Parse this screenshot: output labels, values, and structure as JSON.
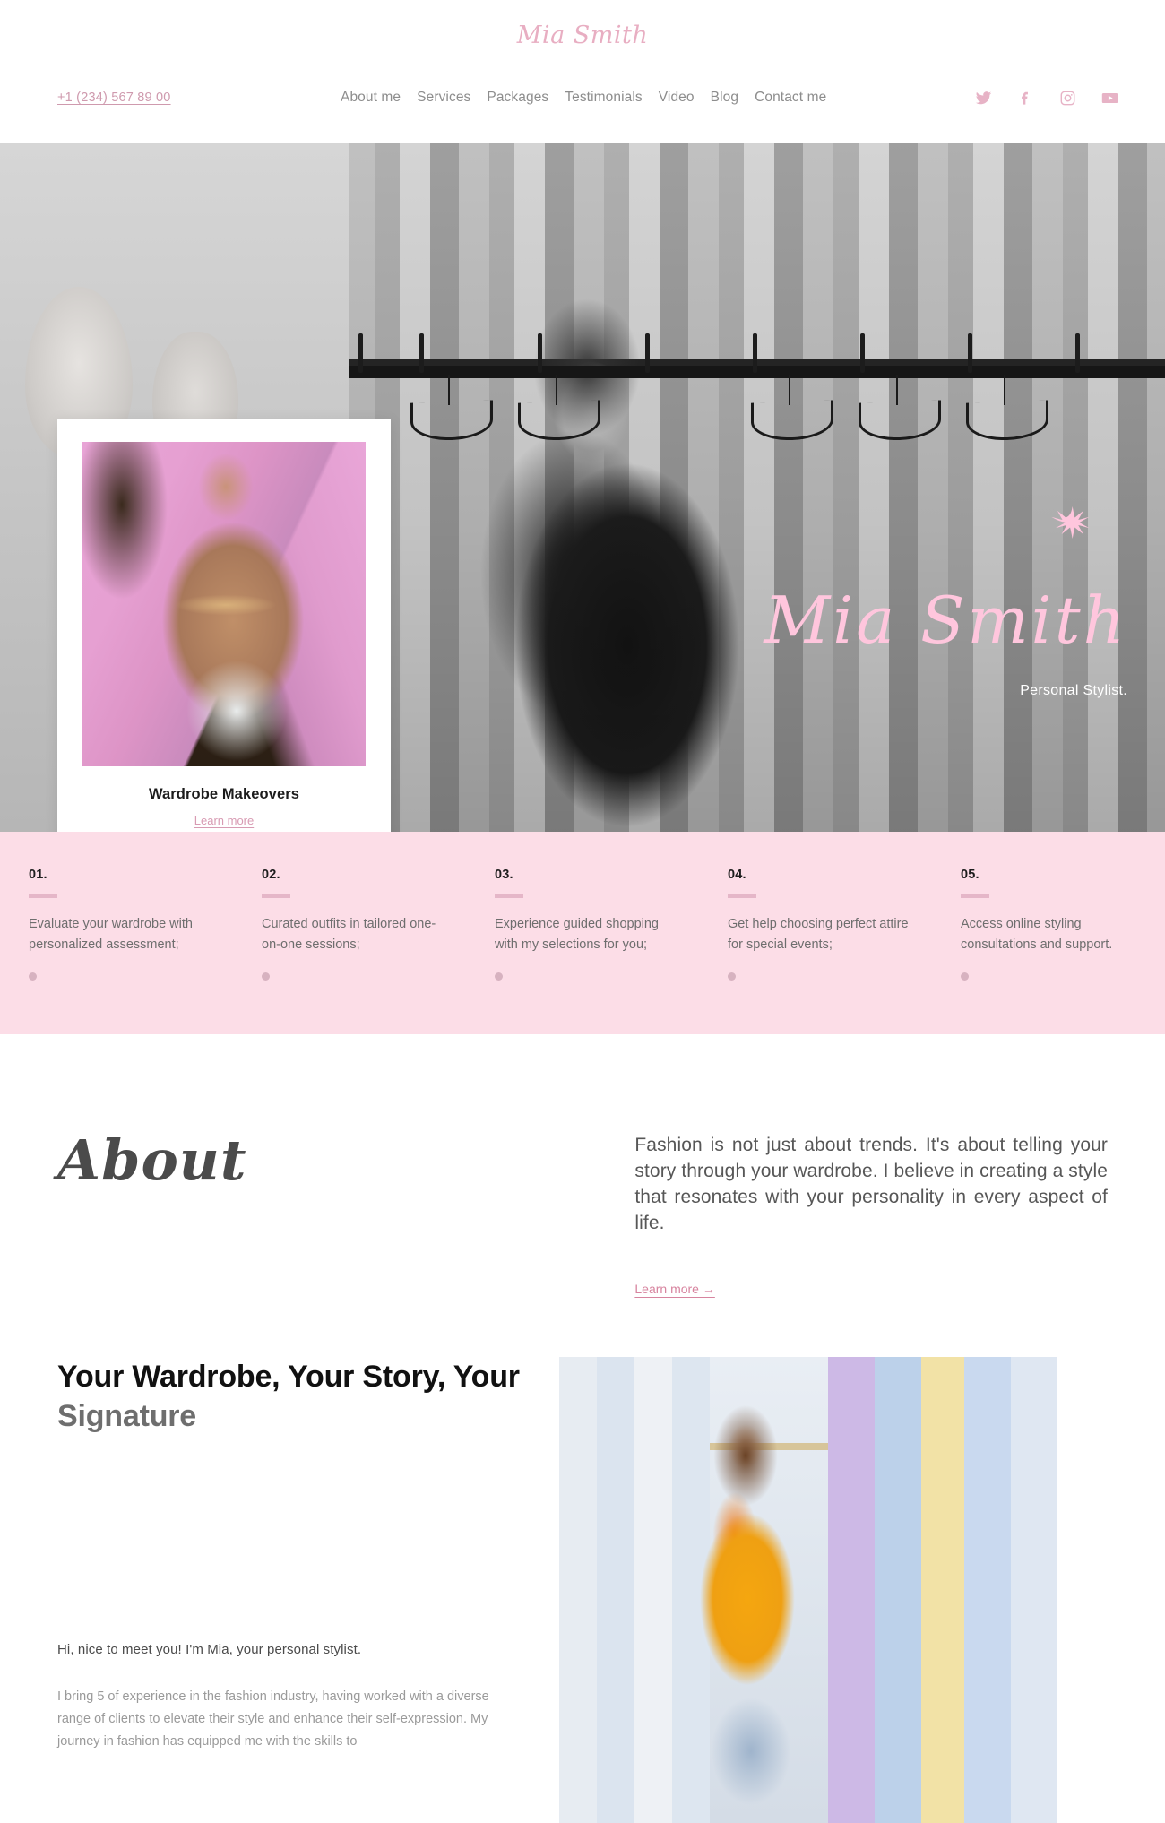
{
  "header": {
    "brand": "Mia Smith",
    "phone": "+1 (234) 567 89 00",
    "nav": [
      {
        "label": "About me"
      },
      {
        "label": "Services"
      },
      {
        "label": "Packages"
      },
      {
        "label": "Testimonials"
      },
      {
        "label": "Video"
      },
      {
        "label": "Blog"
      },
      {
        "label": "Contact me"
      }
    ],
    "social": [
      {
        "name": "twitter-icon"
      },
      {
        "name": "facebook-icon"
      },
      {
        "name": "instagram-icon"
      },
      {
        "name": "youtube-icon"
      }
    ]
  },
  "hero": {
    "title": "Mia Smith",
    "subtitle": "Personal Stylist.",
    "card": {
      "title": "Wardrobe Makeovers",
      "link": "Learn more"
    }
  },
  "features": [
    {
      "num": "01.",
      "text": "Evaluate your wardrobe with personalized assessment;"
    },
    {
      "num": "02.",
      "text": "Curated outfits in tailored one-on-one sessions;"
    },
    {
      "num": "03.",
      "text": "Experience guided shopping with my selections for you;"
    },
    {
      "num": "04.",
      "text": "Get help choosing perfect attire for special events;"
    },
    {
      "num": "05.",
      "text": "Access online styling consultations and support."
    }
  ],
  "about": {
    "word": "About",
    "lead": "Fashion is not just about trends. It's about telling your story through your wardrobe. I believe in creating a style that resonates with your personality in every aspect of life.",
    "more": "Learn more →"
  },
  "story": {
    "heading_part1": "Your Wardrobe, Your Story, Your ",
    "heading_accent": "Signature",
    "greeting": "Hi, nice to meet you! I'm Mia, your personal stylist.",
    "body": "I bring 5 of experience in the fashion industry, having worked with a diverse range of clients to elevate their style and enhance their self-expression. My journey in fashion has equipped me with the skills to"
  },
  "colors": {
    "pink_accent": "#ffc6dd",
    "pink_band": "#fcdde7",
    "brand_pink": "#e8aec2",
    "link_pink": "#d7849f"
  }
}
